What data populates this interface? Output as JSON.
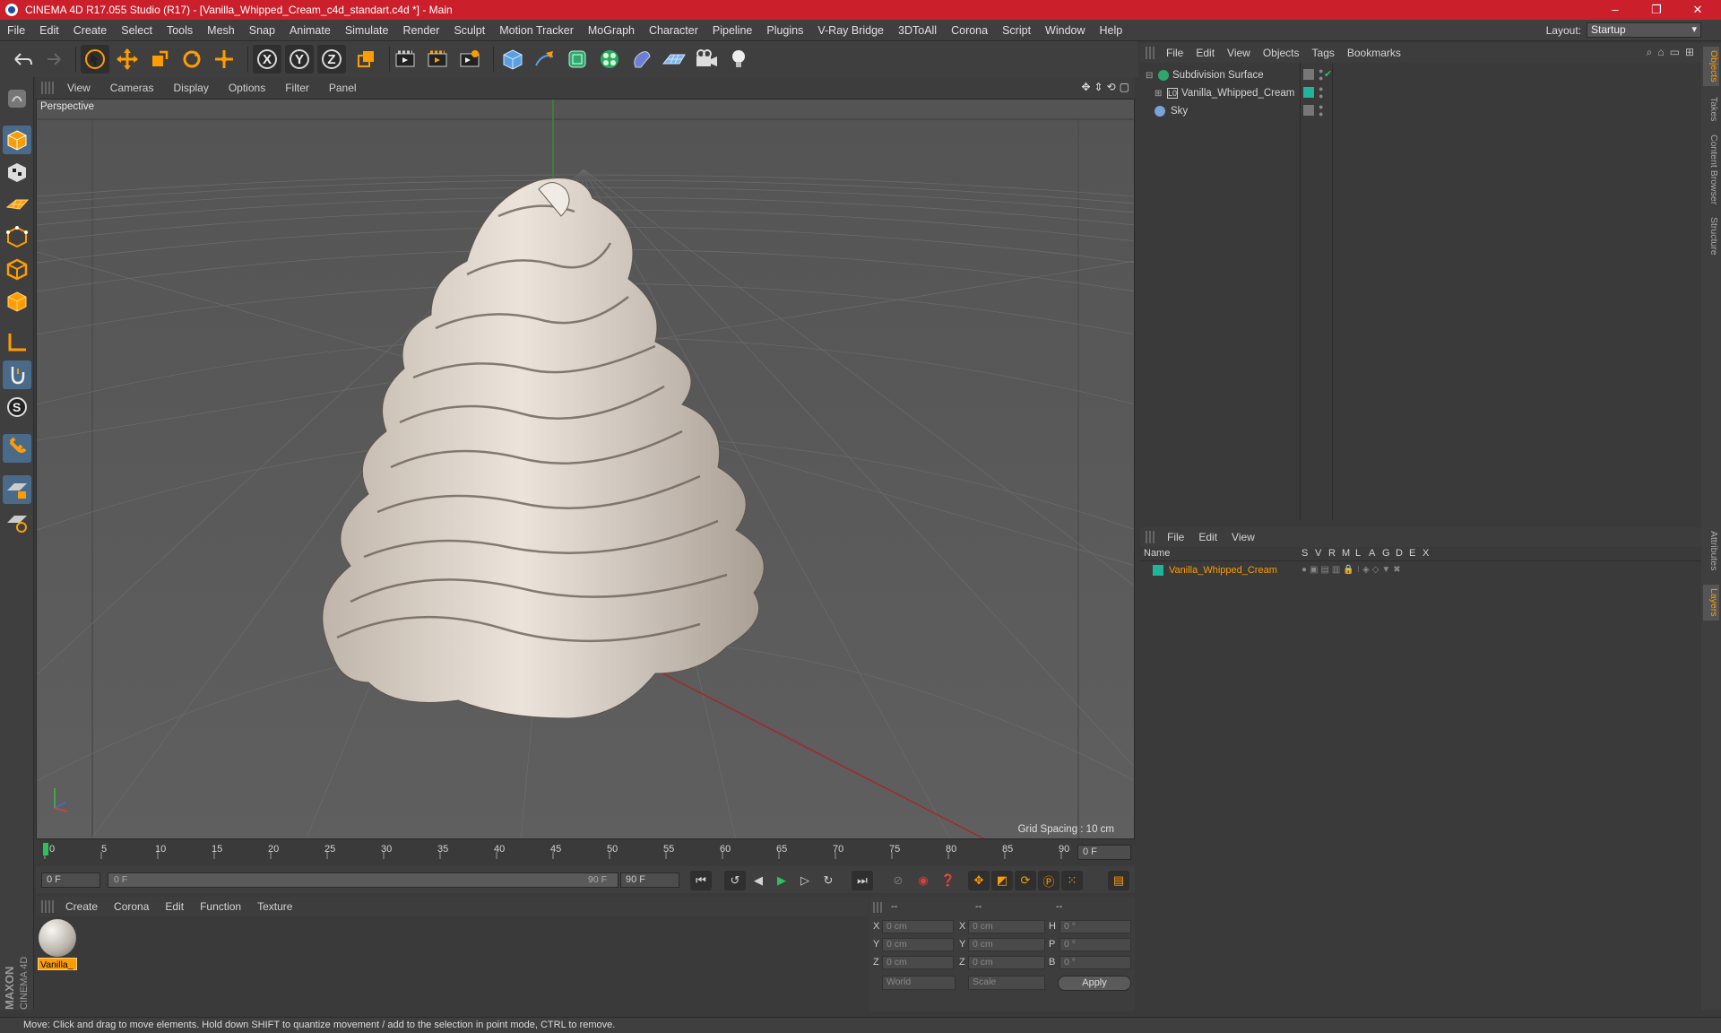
{
  "window": {
    "title": "CINEMA 4D R17.055 Studio (R17) - [Vanilla_Whipped_Cream_c4d_standart.c4d *] - Main",
    "controls": [
      "–",
      "❐",
      "✕"
    ]
  },
  "menubar": {
    "items": [
      "File",
      "Edit",
      "Create",
      "Select",
      "Tools",
      "Mesh",
      "Snap",
      "Animate",
      "Simulate",
      "Render",
      "Sculpt",
      "Motion Tracker",
      "MoGraph",
      "Character",
      "Pipeline",
      "Plugins",
      "V-Ray Bridge",
      "3DToAll",
      "Corona",
      "Script",
      "Window",
      "Help"
    ],
    "layout_label": "Layout:",
    "layout_value": "Startup"
  },
  "toolbar": {
    "axis_x": "X",
    "axis_y": "Y",
    "axis_z": "Z"
  },
  "viewport": {
    "menu": [
      "View",
      "Cameras",
      "Display",
      "Options",
      "Filter",
      "Panel"
    ],
    "label": "Perspective",
    "grid_spacing": "Grid Spacing : 10 cm"
  },
  "timeline": {
    "ticks": [
      "0",
      "5",
      "10",
      "15",
      "20",
      "25",
      "30",
      "35",
      "40",
      "45",
      "50",
      "55",
      "60",
      "65",
      "70",
      "75",
      "80",
      "85",
      "90"
    ],
    "current_frame_field": "0 F",
    "start_field": "0 F",
    "range_start": "0 F",
    "range_end": "90 F",
    "end_field": "90 F"
  },
  "materials": {
    "menu": [
      "Create",
      "Corona",
      "Edit",
      "Function",
      "Texture"
    ],
    "items": [
      {
        "name": "Vanilla_"
      }
    ]
  },
  "coordinates": {
    "header": [
      "--",
      "--",
      "--"
    ],
    "rows": [
      {
        "axis": "X",
        "pos": "0 cm",
        "axis2": "X",
        "size": "0 cm",
        "rot_label": "H",
        "rot": "0 °"
      },
      {
        "axis": "Y",
        "pos": "0 cm",
        "axis2": "Y",
        "size": "0 cm",
        "rot_label": "P",
        "rot": "0 °"
      },
      {
        "axis": "Z",
        "pos": "0 cm",
        "axis2": "Z",
        "size": "0 cm",
        "rot_label": "B",
        "rot": "0 °"
      }
    ],
    "world": "World",
    "scale": "Scale",
    "apply": "Apply"
  },
  "object_manager": {
    "menu": [
      "File",
      "Edit",
      "View",
      "Objects",
      "Tags",
      "Bookmarks"
    ],
    "objects": [
      {
        "name": "Subdivision Surface"
      },
      {
        "name": "Vanilla_Whipped_Cream"
      },
      {
        "name": "Sky"
      }
    ]
  },
  "layer_manager": {
    "menu": [
      "File",
      "Edit",
      "View"
    ],
    "columns": [
      "Name",
      "S",
      "V",
      "R",
      "M",
      "L",
      "A",
      "G",
      "D",
      "E",
      "X"
    ],
    "layers": [
      {
        "name": "Vanilla_Whipped_Cream",
        "color": "#1fb59a"
      }
    ]
  },
  "side_tabs": [
    "Objects",
    "Takes",
    "Content Browser",
    "Structure",
    "Attributes",
    "Layers"
  ],
  "status": {
    "text": "Move: Click and drag to move elements. Hold down SHIFT to quantize movement / add to the selection in point mode, CTRL to remove."
  },
  "branding": {
    "maxon": "MAXON",
    "cinema": "CINEMA 4D"
  },
  "colors": {
    "accent": "#ff9c00",
    "title_bar": "#cc1f2c",
    "layer_green": "#1fb59a"
  }
}
